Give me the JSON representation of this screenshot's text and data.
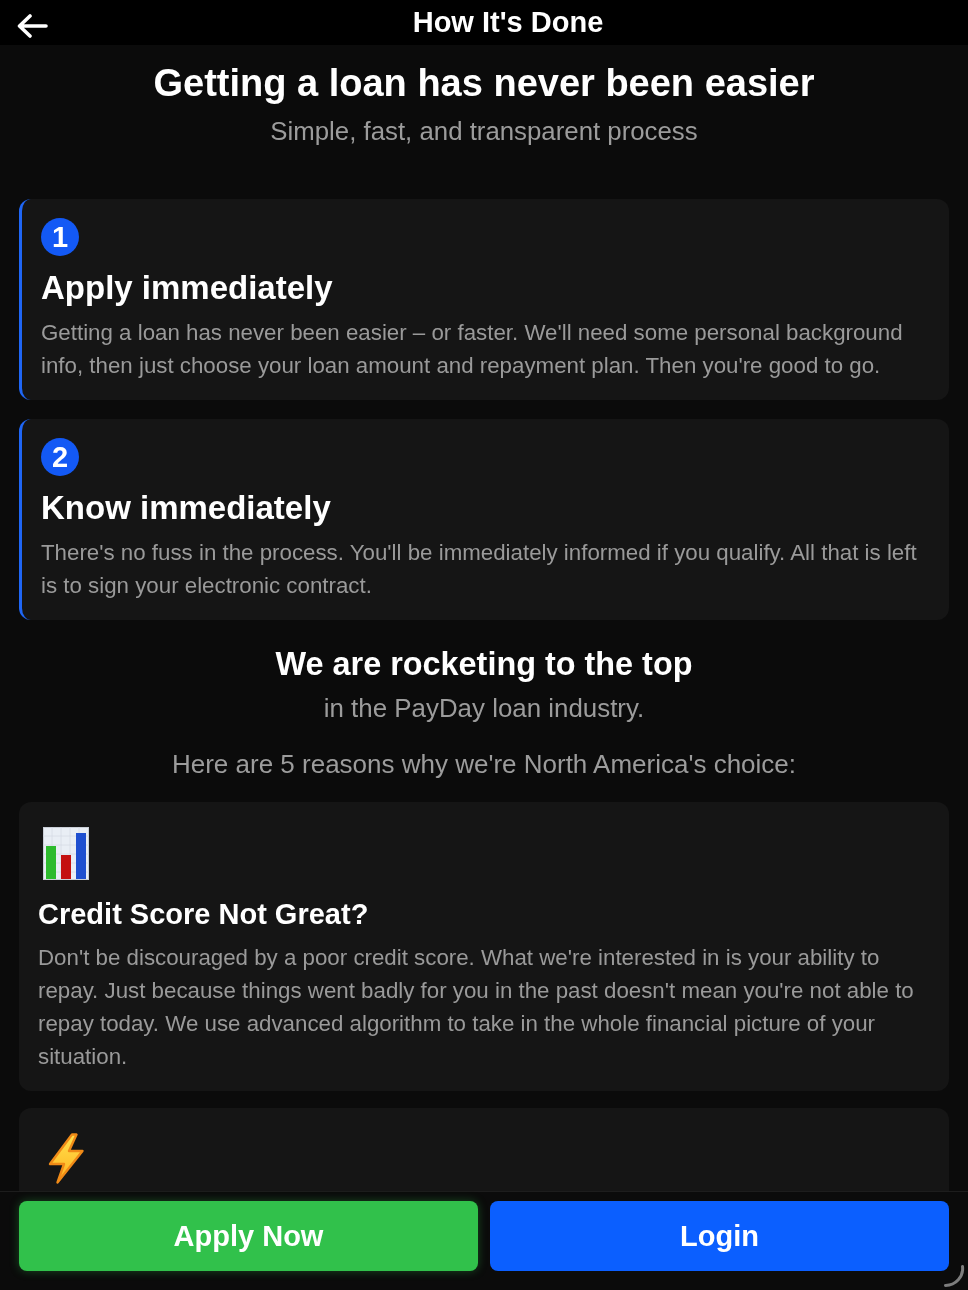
{
  "header": {
    "title": "How It's Done"
  },
  "intro": {
    "heading": "Getting a loan has never been easier",
    "subtitle": "Simple, fast, and transparent process"
  },
  "steps": [
    {
      "number": "1",
      "title": "Apply immediately",
      "description": "Getting a loan has never been easier – or faster. We'll need some personal background info, then just choose your loan amount and repayment plan. Then you're good to go."
    },
    {
      "number": "2",
      "title": "Know immediately",
      "description": "There's no fuss in the process. You'll be immediately informed if you qualify. All that is left is to sign your electronic contract."
    }
  ],
  "reasons_intro": {
    "heading": "We are rocketing to the top",
    "subheading": "in the PayDay loan industry.",
    "lead": "Here are 5 reasons why we're North America's choice:"
  },
  "reasons": [
    {
      "kind": "chart",
      "title": "Credit Score Not Great?",
      "description": "Don't be discouraged by a poor credit score. What we're interested in is your ability to repay. Just because things went badly for you in the past doesn't mean you're not able to repay today. We use advanced algorithm to take in the whole financial picture of your situation."
    },
    {
      "kind": "bolt"
    }
  ],
  "actions": [
    {
      "kind": "primary",
      "label": "Apply Now"
    },
    {
      "kind": "secondary",
      "label": "Login"
    }
  ]
}
